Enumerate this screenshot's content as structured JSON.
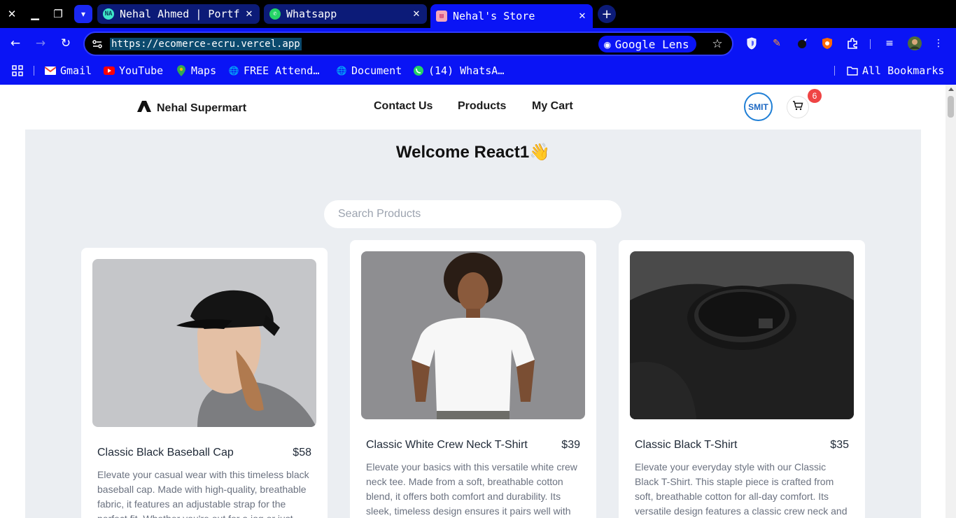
{
  "browser": {
    "tabs": [
      {
        "title": "Nehal Ahmed | Portf",
        "favicon": "na-portfolio-icon",
        "active": false
      },
      {
        "title": "Whatsapp",
        "favicon": "whatsapp-icon",
        "active": false
      },
      {
        "title": "Nehal's Store",
        "favicon": "store-icon",
        "active": true
      }
    ],
    "url": "https://ecomerce-ecru.vercel.app",
    "lens_label": "Google Lens",
    "bookmarks": [
      {
        "label": "Gmail",
        "icon": "gmail-icon"
      },
      {
        "label": "YouTube",
        "icon": "youtube-icon"
      },
      {
        "label": "Maps",
        "icon": "maps-icon"
      },
      {
        "label": "FREE Attend…",
        "icon": "globe-icon"
      },
      {
        "label": "Document",
        "icon": "globe-icon"
      },
      {
        "label": "(14) WhatsA…",
        "icon": "whatsapp-icon"
      }
    ],
    "all_bookmarks_label": "All Bookmarks",
    "colors": {
      "chrome": "#0a14f5",
      "titlebar": "#000000"
    }
  },
  "site": {
    "brand": "Nehal Supermart",
    "nav": {
      "contact": "Contact Us",
      "products": "Products",
      "cart": "My Cart"
    },
    "avatar_text": "SMIT",
    "cart_count": "6",
    "welcome": "Welcome React1👋",
    "search_placeholder": "Search Products"
  },
  "products": [
    {
      "title": "Classic Black Baseball Cap",
      "price": "$58",
      "description": "Elevate your casual wear with this timeless black baseball cap. Made with high-quality, breathable fabric, it features an adjustable strap for the perfect fit. Whether you're out for a jog or just"
    },
    {
      "title": "Classic White Crew Neck T-Shirt",
      "price": "$39",
      "description": "Elevate your basics with this versatile white crew neck tee. Made from a soft, breathable cotton blend, it offers both comfort and durability. Its sleek, timeless design ensures it pairs well with"
    },
    {
      "title": "Classic Black T-Shirt",
      "price": "$35",
      "description": "Elevate your everyday style with our Classic Black T-Shirt. This staple piece is crafted from soft, breathable cotton for all-day comfort. Its versatile design features a classic crew neck and"
    }
  ]
}
